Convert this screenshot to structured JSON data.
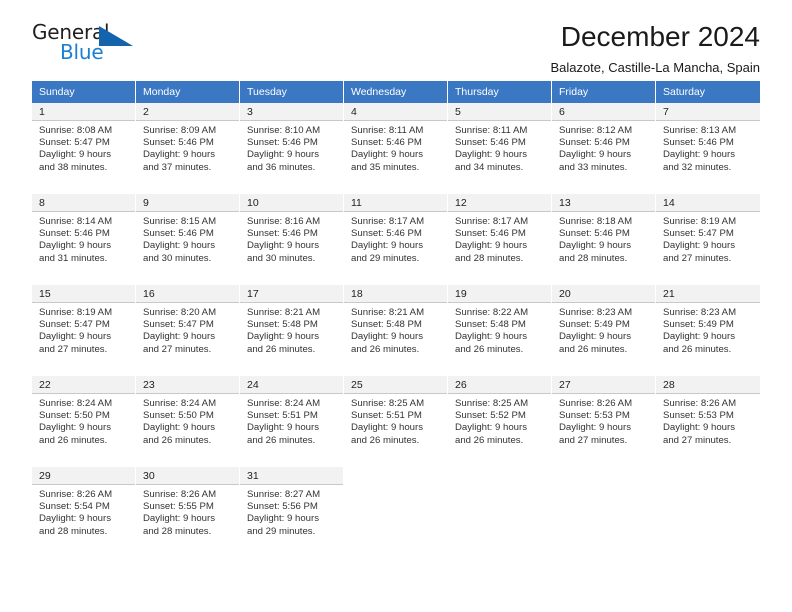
{
  "brand": {
    "line1": "General",
    "line2": "Blue",
    "triangle_color": "#1463ad",
    "blue_color": "#1b7fd4"
  },
  "header": {
    "title": "December 2024",
    "location": "Balazote, Castille-La Mancha, Spain"
  },
  "calendar": {
    "header_color": "#3b78c3",
    "weekdays": [
      "Sunday",
      "Monday",
      "Tuesday",
      "Wednesday",
      "Thursday",
      "Friday",
      "Saturday"
    ],
    "weeks": [
      [
        {
          "day": "1",
          "sunrise": "Sunrise: 8:08 AM",
          "sunset": "Sunset: 5:47 PM",
          "daylight1": "Daylight: 9 hours",
          "daylight2": "and 38 minutes."
        },
        {
          "day": "2",
          "sunrise": "Sunrise: 8:09 AM",
          "sunset": "Sunset: 5:46 PM",
          "daylight1": "Daylight: 9 hours",
          "daylight2": "and 37 minutes."
        },
        {
          "day": "3",
          "sunrise": "Sunrise: 8:10 AM",
          "sunset": "Sunset: 5:46 PM",
          "daylight1": "Daylight: 9 hours",
          "daylight2": "and 36 minutes."
        },
        {
          "day": "4",
          "sunrise": "Sunrise: 8:11 AM",
          "sunset": "Sunset: 5:46 PM",
          "daylight1": "Daylight: 9 hours",
          "daylight2": "and 35 minutes."
        },
        {
          "day": "5",
          "sunrise": "Sunrise: 8:11 AM",
          "sunset": "Sunset: 5:46 PM",
          "daylight1": "Daylight: 9 hours",
          "daylight2": "and 34 minutes."
        },
        {
          "day": "6",
          "sunrise": "Sunrise: 8:12 AM",
          "sunset": "Sunset: 5:46 PM",
          "daylight1": "Daylight: 9 hours",
          "daylight2": "and 33 minutes."
        },
        {
          "day": "7",
          "sunrise": "Sunrise: 8:13 AM",
          "sunset": "Sunset: 5:46 PM",
          "daylight1": "Daylight: 9 hours",
          "daylight2": "and 32 minutes."
        }
      ],
      [
        {
          "day": "8",
          "sunrise": "Sunrise: 8:14 AM",
          "sunset": "Sunset: 5:46 PM",
          "daylight1": "Daylight: 9 hours",
          "daylight2": "and 31 minutes."
        },
        {
          "day": "9",
          "sunrise": "Sunrise: 8:15 AM",
          "sunset": "Sunset: 5:46 PM",
          "daylight1": "Daylight: 9 hours",
          "daylight2": "and 30 minutes."
        },
        {
          "day": "10",
          "sunrise": "Sunrise: 8:16 AM",
          "sunset": "Sunset: 5:46 PM",
          "daylight1": "Daylight: 9 hours",
          "daylight2": "and 30 minutes."
        },
        {
          "day": "11",
          "sunrise": "Sunrise: 8:17 AM",
          "sunset": "Sunset: 5:46 PM",
          "daylight1": "Daylight: 9 hours",
          "daylight2": "and 29 minutes."
        },
        {
          "day": "12",
          "sunrise": "Sunrise: 8:17 AM",
          "sunset": "Sunset: 5:46 PM",
          "daylight1": "Daylight: 9 hours",
          "daylight2": "and 28 minutes."
        },
        {
          "day": "13",
          "sunrise": "Sunrise: 8:18 AM",
          "sunset": "Sunset: 5:46 PM",
          "daylight1": "Daylight: 9 hours",
          "daylight2": "and 28 minutes."
        },
        {
          "day": "14",
          "sunrise": "Sunrise: 8:19 AM",
          "sunset": "Sunset: 5:47 PM",
          "daylight1": "Daylight: 9 hours",
          "daylight2": "and 27 minutes."
        }
      ],
      [
        {
          "day": "15",
          "sunrise": "Sunrise: 8:19 AM",
          "sunset": "Sunset: 5:47 PM",
          "daylight1": "Daylight: 9 hours",
          "daylight2": "and 27 minutes."
        },
        {
          "day": "16",
          "sunrise": "Sunrise: 8:20 AM",
          "sunset": "Sunset: 5:47 PM",
          "daylight1": "Daylight: 9 hours",
          "daylight2": "and 27 minutes."
        },
        {
          "day": "17",
          "sunrise": "Sunrise: 8:21 AM",
          "sunset": "Sunset: 5:48 PM",
          "daylight1": "Daylight: 9 hours",
          "daylight2": "and 26 minutes."
        },
        {
          "day": "18",
          "sunrise": "Sunrise: 8:21 AM",
          "sunset": "Sunset: 5:48 PM",
          "daylight1": "Daylight: 9 hours",
          "daylight2": "and 26 minutes."
        },
        {
          "day": "19",
          "sunrise": "Sunrise: 8:22 AM",
          "sunset": "Sunset: 5:48 PM",
          "daylight1": "Daylight: 9 hours",
          "daylight2": "and 26 minutes."
        },
        {
          "day": "20",
          "sunrise": "Sunrise: 8:23 AM",
          "sunset": "Sunset: 5:49 PM",
          "daylight1": "Daylight: 9 hours",
          "daylight2": "and 26 minutes."
        },
        {
          "day": "21",
          "sunrise": "Sunrise: 8:23 AM",
          "sunset": "Sunset: 5:49 PM",
          "daylight1": "Daylight: 9 hours",
          "daylight2": "and 26 minutes."
        }
      ],
      [
        {
          "day": "22",
          "sunrise": "Sunrise: 8:24 AM",
          "sunset": "Sunset: 5:50 PM",
          "daylight1": "Daylight: 9 hours",
          "daylight2": "and 26 minutes."
        },
        {
          "day": "23",
          "sunrise": "Sunrise: 8:24 AM",
          "sunset": "Sunset: 5:50 PM",
          "daylight1": "Daylight: 9 hours",
          "daylight2": "and 26 minutes."
        },
        {
          "day": "24",
          "sunrise": "Sunrise: 8:24 AM",
          "sunset": "Sunset: 5:51 PM",
          "daylight1": "Daylight: 9 hours",
          "daylight2": "and 26 minutes."
        },
        {
          "day": "25",
          "sunrise": "Sunrise: 8:25 AM",
          "sunset": "Sunset: 5:51 PM",
          "daylight1": "Daylight: 9 hours",
          "daylight2": "and 26 minutes."
        },
        {
          "day": "26",
          "sunrise": "Sunrise: 8:25 AM",
          "sunset": "Sunset: 5:52 PM",
          "daylight1": "Daylight: 9 hours",
          "daylight2": "and 26 minutes."
        },
        {
          "day": "27",
          "sunrise": "Sunrise: 8:26 AM",
          "sunset": "Sunset: 5:53 PM",
          "daylight1": "Daylight: 9 hours",
          "daylight2": "and 27 minutes."
        },
        {
          "day": "28",
          "sunrise": "Sunrise: 8:26 AM",
          "sunset": "Sunset: 5:53 PM",
          "daylight1": "Daylight: 9 hours",
          "daylight2": "and 27 minutes."
        }
      ],
      [
        {
          "day": "29",
          "sunrise": "Sunrise: 8:26 AM",
          "sunset": "Sunset: 5:54 PM",
          "daylight1": "Daylight: 9 hours",
          "daylight2": "and 28 minutes."
        },
        {
          "day": "30",
          "sunrise": "Sunrise: 8:26 AM",
          "sunset": "Sunset: 5:55 PM",
          "daylight1": "Daylight: 9 hours",
          "daylight2": "and 28 minutes."
        },
        {
          "day": "31",
          "sunrise": "Sunrise: 8:27 AM",
          "sunset": "Sunset: 5:56 PM",
          "daylight1": "Daylight: 9 hours",
          "daylight2": "and 29 minutes."
        },
        {
          "day": "",
          "sunrise": "",
          "sunset": "",
          "daylight1": "",
          "daylight2": ""
        },
        {
          "day": "",
          "sunrise": "",
          "sunset": "",
          "daylight1": "",
          "daylight2": ""
        },
        {
          "day": "",
          "sunrise": "",
          "sunset": "",
          "daylight1": "",
          "daylight2": ""
        },
        {
          "day": "",
          "sunrise": "",
          "sunset": "",
          "daylight1": "",
          "daylight2": ""
        }
      ]
    ]
  }
}
